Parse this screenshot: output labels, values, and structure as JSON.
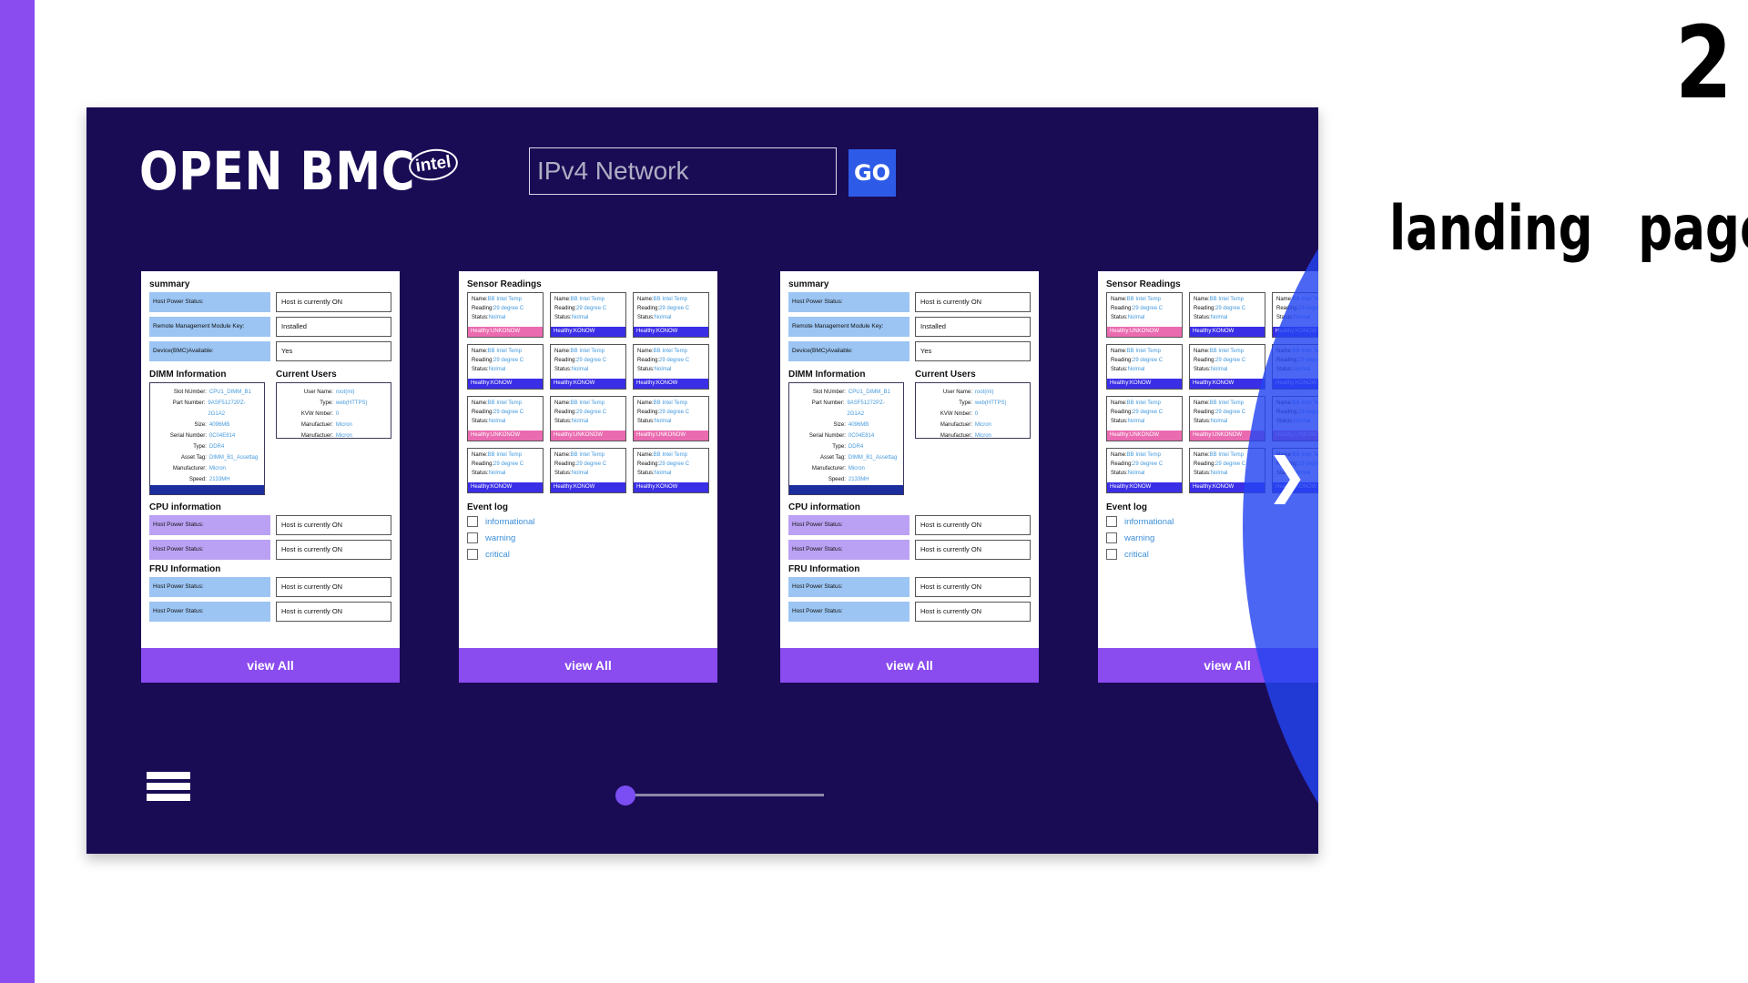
{
  "slide": {
    "number": "2",
    "label": "landing page"
  },
  "header": {
    "logo": "OPEN BMC",
    "brand": "intel",
    "search_placeholder": "IPv4 Network",
    "go_label": "GO"
  },
  "summary_card": {
    "title": "summary",
    "rows": [
      {
        "k": "Host Power Status:",
        "v": "Host is currently ON"
      },
      {
        "k": "Remote Management Module Key:",
        "v": "Installed"
      },
      {
        "k": "Device(BMC)Available:",
        "v": "Yes"
      }
    ],
    "dimm_title": "DIMM Information",
    "users_title": "Current Users",
    "dimm": [
      {
        "k": "Slot NUmber:",
        "v": "CPU1_DIMM_B1"
      },
      {
        "k": "Part Number:",
        "v": "9ASF51272PZ-2G1A2"
      },
      {
        "k": "Size:",
        "v": "4096MB"
      },
      {
        "k": "Serial Number:",
        "v": "0C04E814"
      },
      {
        "k": "Type:",
        "v": "DDR4"
      },
      {
        "k": "Asset Tag:",
        "v": "DIMM_B1_Assettag"
      },
      {
        "k": "Manufacturer:",
        "v": "Micron"
      },
      {
        "k": "Speed:",
        "v": "2133MH"
      }
    ],
    "users": [
      {
        "k": "User Name:",
        "v": "root(mi)"
      },
      {
        "k": "Type:",
        "v": "web(HTTPS)"
      },
      {
        "k": "KVW Nmber:",
        "v": "0"
      },
      {
        "k": "Manufactuer:",
        "v": "Micron"
      },
      {
        "k": "Manufactuer:",
        "v": "Micron"
      }
    ],
    "cpu_title": "CPU information",
    "cpu": [
      {
        "k": "Host Power Status:",
        "v": "Host is currently ON"
      },
      {
        "k": "Host Power Status:",
        "v": "Host is currently ON"
      }
    ],
    "fru_title": "FRU Information",
    "fru": [
      {
        "k": "Host Power Status:",
        "v": "Host is currently ON"
      },
      {
        "k": "Host Power Status:",
        "v": "Host is currently ON"
      }
    ],
    "footer": "view All"
  },
  "sensor_card": {
    "title": "Sensor Readings",
    "name_label": "Name:",
    "name_value": "BB Intel Temp",
    "reading_label": "Reading:",
    "reading_value": "29 degree C",
    "status_label": "Status:",
    "status_value": "Nolmal",
    "health": [
      "Healthy:UNKONOW",
      "Healthy:KONOW",
      "Healthy:KONOW",
      "Healthy:KONOW",
      "Healthy:KONOW",
      "Healthy:KONOW",
      "Healthy:UNKONOW",
      "Healthy:UNKONOW",
      "Healthy:UNKONOW",
      "Healthy:KONOW",
      "Healthy:KONOW",
      "Healthy:KONOW"
    ],
    "event_title": "Event log",
    "events": [
      "informational",
      "warning",
      "critical"
    ],
    "footer": "view All"
  },
  "colors": {
    "frame_bg": "#1a0b55",
    "accent_purple": "#8a4bef",
    "go_blue": "#2d5be7",
    "health_pink": "#ea6bb0",
    "health_blue": "#3a2ee6"
  },
  "icons": {
    "menu": "hamburger-icon",
    "next": "chevron-right-icon"
  }
}
